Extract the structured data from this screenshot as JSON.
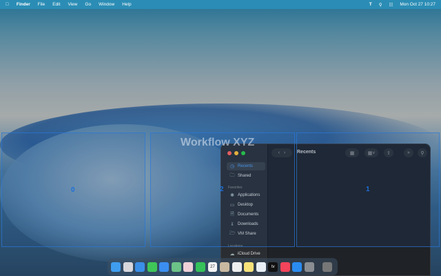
{
  "menubar": {
    "app": "Finder",
    "items": [
      "File",
      "Edit",
      "View",
      "Go",
      "Window",
      "Help"
    ],
    "clock": "Mon Oct 27  10:27"
  },
  "overlay": {
    "title": "Workflow XYZ",
    "zones": [
      "0",
      "1",
      "2"
    ]
  },
  "finder": {
    "title": "Recents",
    "sidebar": {
      "top": [
        {
          "label": "Recents",
          "icon": "clock-icon"
        },
        {
          "label": "Shared",
          "icon": "shared-folder-icon"
        }
      ],
      "favorites_heading": "Favorites",
      "favorites": [
        {
          "label": "Applications",
          "icon": "applications-icon"
        },
        {
          "label": "Desktop",
          "icon": "desktop-icon"
        },
        {
          "label": "Documents",
          "icon": "document-icon"
        },
        {
          "label": "Downloads",
          "icon": "download-icon"
        },
        {
          "label": "VM Share",
          "icon": "folder-icon"
        }
      ],
      "locations_heading": "Locations",
      "locations": [
        {
          "label": "iCloud Drive",
          "icon": "cloud-icon"
        }
      ]
    }
  },
  "dock": {
    "apps": [
      "Finder",
      "Launchpad",
      "Safari",
      "Messages",
      "Mail",
      "Maps",
      "Photos",
      "FaceTime",
      "Calendar",
      "Contacts",
      "Reminders",
      "Notes",
      "Freeform",
      "TV",
      "Music",
      "App Store",
      "System Settings",
      "Trash"
    ],
    "calendar_day": "27",
    "tv_label": "tv"
  }
}
